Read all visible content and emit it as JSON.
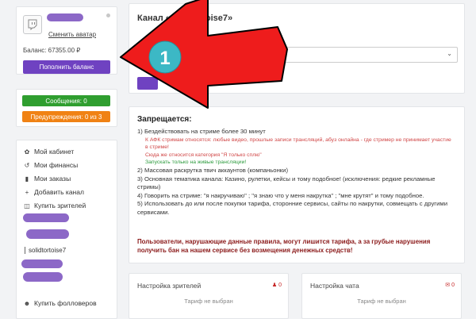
{
  "profile": {
    "change_avatar": "Сменить аватар",
    "balance": "Баланс: 67355.00 ₽",
    "topup_label": "Пополнить баланс"
  },
  "notifications": {
    "messages": "Сообщения: 0",
    "warnings": "Предупреждения: 0 из 3"
  },
  "sidebar": {
    "items": [
      {
        "label": "Мой кабинет",
        "icon": "palette-icon"
      },
      {
        "label": "Мои финансы",
        "icon": "history-icon"
      },
      {
        "label": "Мои заказы",
        "icon": "book-icon"
      },
      {
        "label": "Добавить канал",
        "icon": "plus-icon"
      },
      {
        "label": "Купить зрителей",
        "icon": "twitch-icon"
      }
    ],
    "channel_name": "solidtortoise7",
    "buy_followers": "Купить фолловеров"
  },
  "channel": {
    "title": "Канал «solidtortoise7»"
  },
  "rules": {
    "title": "Запрещается:",
    "item1": "1) Бездействовать на стриме более 30 минут",
    "item1_sub1": "К АФК стримам относятся: любые видео, прошлые записи трансляций, абуз онлайна - где стример не принимает участие в стриме!",
    "item1_sub2": "Сюда же относится категория \"Я только сплю\"",
    "item1_sub3": "Запускать только на живые трансляции!",
    "item2": "2) Массовая раскрутка твич аккаунтов (компаньонки)",
    "item3": "3) Основная тематика канала: Казино, рулетки, кейсы и тому подобное! (исключения: редкие рекламные стримы)",
    "item4": "4) Говорить на стриме: \"я накручиваю\" ; \"я знаю что у меня накрутка\" ; \"мне крутят\" и тому подобное.",
    "item5": "5) Использовать до или после покупки тарифа, сторонние сервисы, сайты по накрутки, совмещать с другими сервисами.",
    "warning": "Пользователи, нарушающие данные правила, могут лишится тарифа, а за грубые нарушения получить бан на нашем сервисе без возмещения денежных средств!"
  },
  "viewers_settings": {
    "title": "Настройка зрителей",
    "badge": "0",
    "status": "Тариф не выбран"
  },
  "chat_settings": {
    "title": "Настройка чата",
    "badge": "0",
    "status": "Тариф не выбран"
  },
  "annotation": {
    "number": "1",
    "color": "#ee1c1c"
  }
}
